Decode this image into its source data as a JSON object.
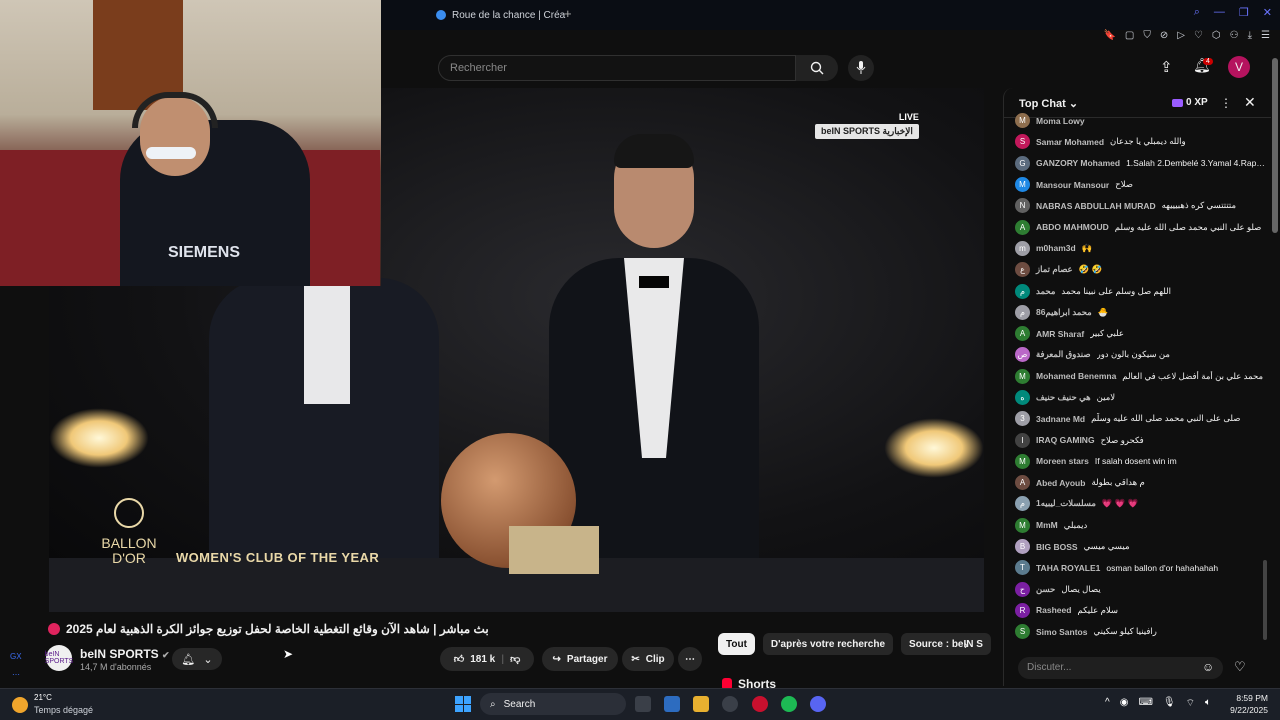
{
  "browser": {
    "tab_title": "Roue de la chance | Créa",
    "new_tab": "+"
  },
  "header": {
    "search_placeholder": "Rechercher",
    "notification_count": "4",
    "avatar_letter": "V"
  },
  "video": {
    "live_label": "LIVE",
    "broadcaster_badge": "beIN SPORTS الإخبارية",
    "ballon_logo": "BALLON D'OR",
    "lower_third": "WOMEN'S CLUB OF THE YEAR",
    "webcam_shirt_text": "SIEMENS",
    "title": "بث مباشر | شاهد الآن وقائع التغطية الخاصة لحفل توزيع جوائز الكرة الذهبية لعام 2025"
  },
  "channel": {
    "avatar_text": "beIN SPORTS",
    "name": "beIN SPORTS",
    "verified": "✔",
    "subscribers": "14,7 M d'abonnés"
  },
  "actions": {
    "likes": "181 k",
    "share": "Partager",
    "clip": "Clip",
    "more": "⋯"
  },
  "chips": [
    "Tout",
    "D'après votre recherche",
    "Source : beIN S"
  ],
  "shorts_label": "Shorts",
  "chat": {
    "title": "Top Chat",
    "xp": "0 XP",
    "input_placeholder": "Discuter...",
    "messages": [
      {
        "initial": "M",
        "color": "#8e6e4e",
        "author": "Moma Lowy",
        "text": ""
      },
      {
        "initial": "S",
        "color": "#c2185b",
        "author": "Samar Mohamed",
        "text": "والله ديمبلي يا جدعان"
      },
      {
        "initial": "G",
        "color": "#5b6b7e",
        "author": "GANZORY Mohamed",
        "text": "1.Salah 2.Dembelé 3.Yamal 4.Raphinha"
      },
      {
        "initial": "M",
        "color": "#1e88e5",
        "author": "Mansour Mansour",
        "text": "صلاح"
      },
      {
        "initial": "N",
        "color": "#616161",
        "author": "NABRAS ABDULLAH MURAD",
        "text": "متتتتسي كره ذهبيييهه"
      },
      {
        "initial": "A",
        "color": "#2e7d32",
        "author": "ABDO MAHMOUD",
        "text": "صلو على النبي محمد صلى الله عليه وسلم"
      },
      {
        "initial": "m",
        "color": "#9e9ea6",
        "author": "m0ham3d",
        "text": "🙌"
      },
      {
        "initial": "ع",
        "color": "#6d4c41",
        "author": "عصام تماز",
        "text": "🤣 🤣"
      },
      {
        "initial": "م",
        "color": "#00897b",
        "author": "محمد",
        "text": "اللهم صل وسلم على نبينا محمد"
      },
      {
        "initial": "م",
        "color": "#9e9ea6",
        "author": "محمد ابراهيم86",
        "text": "🐣"
      },
      {
        "initial": "A",
        "color": "#2e7d32",
        "author": "AMR Sharaf",
        "text": "علبي كبير"
      },
      {
        "initial": "ص",
        "color": "#ba68c8",
        "author": "صندوق المعرفة",
        "text": "من سيكون بالون دور"
      },
      {
        "initial": "M",
        "color": "#2e7d32",
        "author": "Mohamed Benemna",
        "text": "محمد علي بن أمة أفضل لاعب في العالم"
      },
      {
        "initial": "ه",
        "color": "#00897b",
        "author": "هي حنيف حنيف",
        "text": "لامين"
      },
      {
        "initial": "3",
        "color": "#9e9ea6",
        "author": "3adnane Md",
        "text": "صلى على النبي محمد صلى الله عليه وسلّم"
      },
      {
        "initial": "I",
        "color": "#424242",
        "author": "IRAQ GAMING",
        "text": "فكحرو صلاح"
      },
      {
        "initial": "M",
        "color": "#2e7d32",
        "author": "Moreen stars",
        "text": "If salah dosent win im"
      },
      {
        "initial": "A",
        "color": "#6d4c41",
        "author": "Abed Ayoub",
        "text": "م هداقي بطولة"
      },
      {
        "initial": "م",
        "color": "#8aa0b0",
        "author": "مسلسلات_ليبيه1",
        "text": "💗 💗 💗"
      },
      {
        "initial": "M",
        "color": "#2e7d32",
        "author": "MmM",
        "text": "ديمبلي"
      },
      {
        "initial": "B",
        "color": "#b0a0c0",
        "author": "BIG BOSS",
        "text": "ميسي ميسي"
      },
      {
        "initial": "T",
        "color": "#5b7b8e",
        "author": "TAHA ROYALE1",
        "text": "osman ballon d'or hahahahah"
      },
      {
        "initial": "ح",
        "color": "#7b1fa2",
        "author": "حسن",
        "text": "يصال يصال"
      },
      {
        "initial": "R",
        "color": "#7b1fa2",
        "author": "Rasheed",
        "text": "سلام عليكم"
      },
      {
        "initial": "S",
        "color": "#2e7d32",
        "author": "Simo Santos",
        "text": "رافينيا كيلو سكيني"
      }
    ]
  },
  "taskbar": {
    "temperature": "21°C",
    "weather": "Temps dégagé",
    "search": "Search",
    "time": "8:59 PM",
    "date": "9/22/2025"
  },
  "rail": {
    "gx": "GX"
  },
  "colors": {
    "accent": "#3ea6ff",
    "live_red": "#e0245e",
    "avatar": "#b5135e"
  }
}
